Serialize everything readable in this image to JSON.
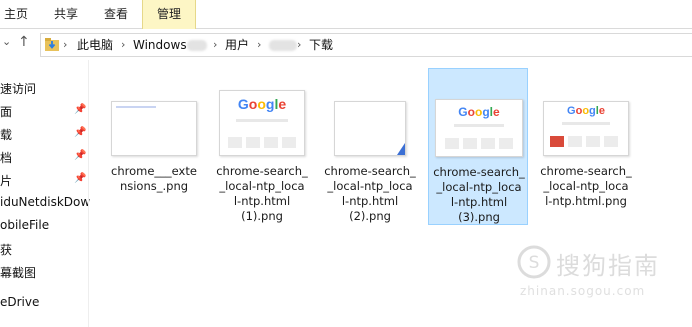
{
  "ribbon": {
    "tabs": [
      "主页",
      "共享",
      "查看"
    ],
    "active_tab": "管理"
  },
  "address": {
    "crumbs": [
      "此电脑",
      "Windows",
      "用户",
      "下载"
    ],
    "up_glyph": "↑",
    "back_glyph": "‹"
  },
  "sidebar": {
    "items": [
      "速访问",
      "面",
      "载",
      "档",
      "片",
      "iduNetdiskDow",
      "obileFile",
      "获",
      "幕截图",
      "eDrive"
    ]
  },
  "files": [
    {
      "name": "chrome___extensions_.png"
    },
    {
      "name": "chrome-search___local-ntp_local-ntp.html (1).png"
    },
    {
      "name": "chrome-search___local-ntp_local-ntp.html (2).png"
    },
    {
      "name": "chrome-search___local-ntp_local-ntp.html (3).png"
    },
    {
      "name": "chrome-search___local-ntp_local-ntp.html.png"
    }
  ],
  "file_labels": [
    [
      "chrome___exte",
      "nsions_.png"
    ],
    [
      "chrome-search_",
      "_local-ntp_loca",
      "l-ntp.html",
      "(1).png"
    ],
    [
      "chrome-search_",
      "_local-ntp_loca",
      "l-ntp.html",
      "(2).png"
    ],
    [
      "chrome-search_",
      "_local-ntp_loca",
      "l-ntp.html",
      "(3).png"
    ],
    [
      "chrome-search_",
      "_local-ntp_loca",
      "l-ntp.html.png"
    ]
  ],
  "google_logo": "Google",
  "watermark": {
    "text": "搜狗指南",
    "url": "zhinan.sogou.com"
  },
  "colors": {
    "selection": "#cce8ff",
    "selection_border": "#99d1ff",
    "ribbon_active": "#fdf6c5"
  }
}
